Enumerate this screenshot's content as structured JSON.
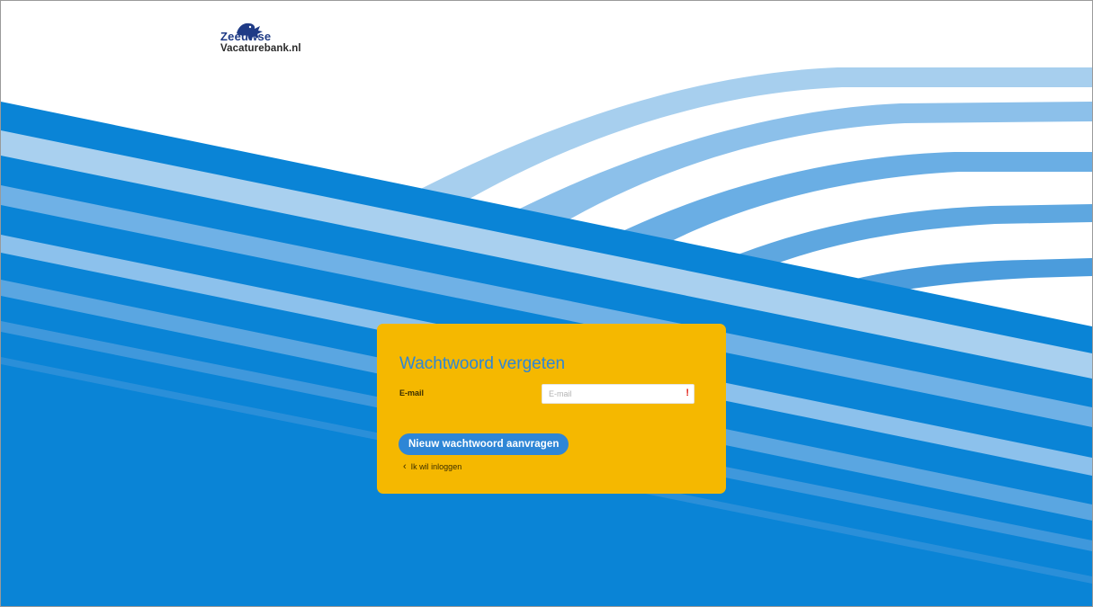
{
  "logo": {
    "line1": "Zeeuwse",
    "line2": "Vacaturebank.nl",
    "icon": "lion-icon"
  },
  "colors": {
    "primary_blue": "#0a84d6",
    "light_blue": "#9fcbee",
    "mid_blue": "#5fa6e2",
    "card_yellow": "#f5b800",
    "title_blue": "#2e86d6",
    "required_red": "#e2231a"
  },
  "form": {
    "title": "Wachtwoord vergeten",
    "email_label": "E-mail",
    "email_placeholder": "E-mail",
    "email_value": "",
    "required_marker": "!",
    "submit_label": "Nieuw wachtwoord aanvragen",
    "back_label": "Ik wil inloggen",
    "back_icon": "chevron-left-icon"
  }
}
